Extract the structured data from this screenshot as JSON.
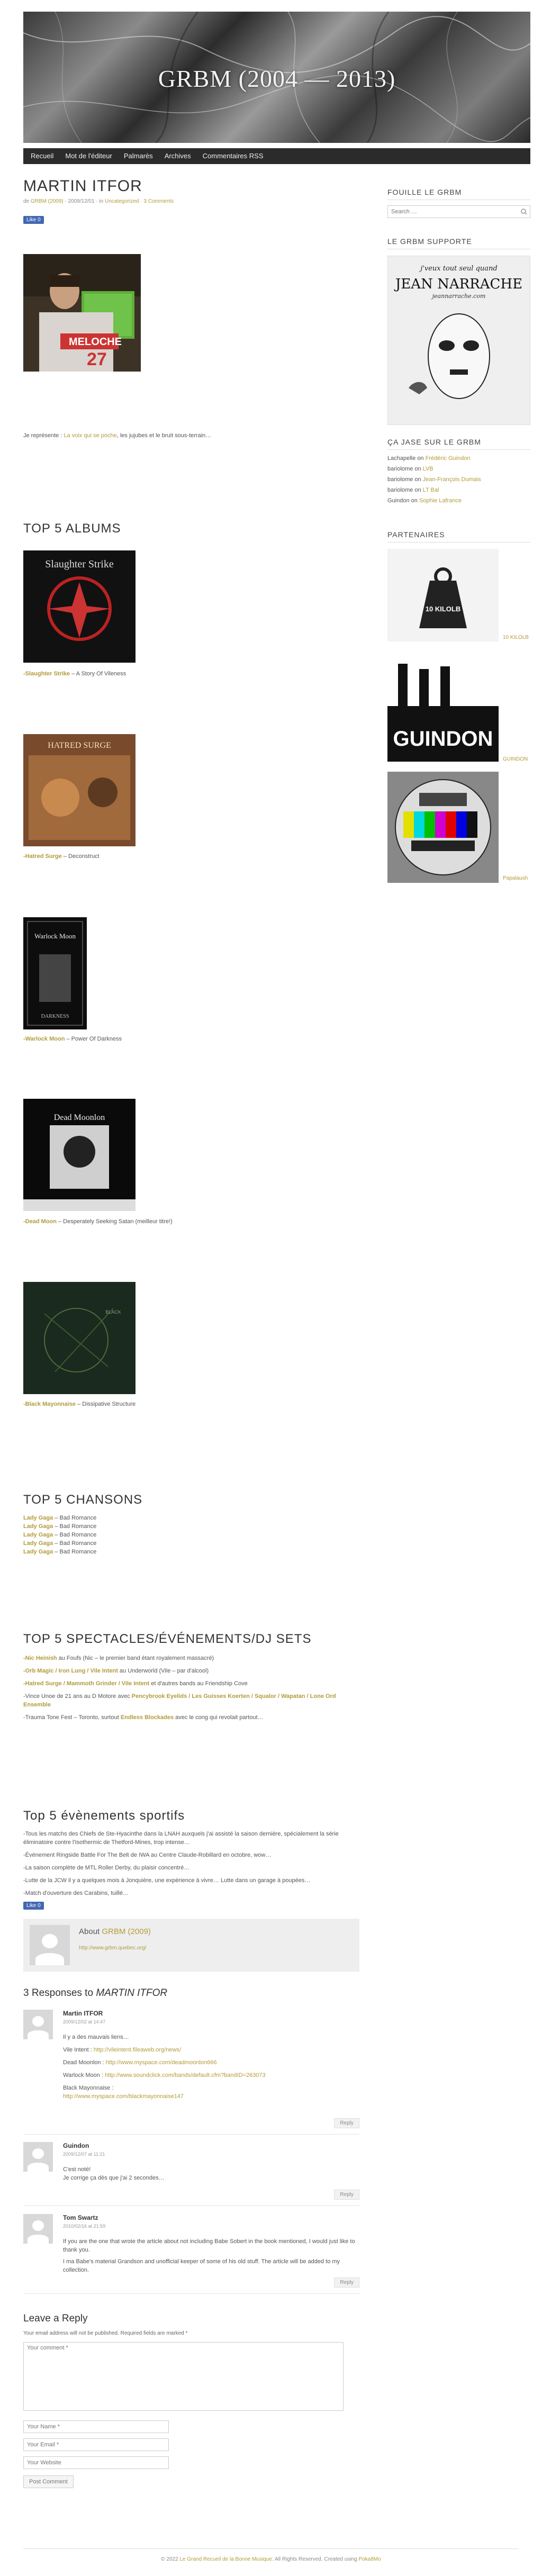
{
  "header": {
    "site_title": "GRBM (2004 — 2013)",
    "nav": [
      "Recueil",
      "Mot de l'éditeur",
      "Palmarès",
      "Archives",
      "Commentaires RSS"
    ]
  },
  "post": {
    "title": "MARTIN ITFOR",
    "meta_by": "de",
    "meta_author": "GRBM (2009)",
    "meta_in": "· 2009/12/01 · in",
    "meta_category": "Uncategorized",
    "meta_comments": "3 Comments",
    "like_label": "Like 0",
    "intro_pre": "Je représente :",
    "intro_link": "La voix qui se poche",
    "intro_post": ", les jujubes et le bruit sous-terrain…"
  },
  "albums": {
    "heading": "TOP 5 ALBUMS",
    "items": [
      {
        "artist": "-Slaughter Strike",
        "title": " – A Story Of Vileness"
      },
      {
        "artist": "-Hatred Surge",
        "title": " – Deconstruct"
      },
      {
        "artist": "-Warlock Moon",
        "title": " – Power Of Darkness"
      },
      {
        "artist": "-Dead Moon",
        "title": " – Desperately Seeking Satan (meilleur titre!)"
      },
      {
        "artist": "-Black Mayonnaise",
        "title": " – Dissipative Structure"
      }
    ]
  },
  "songs": {
    "heading": "TOP 5 CHANSONS",
    "items": [
      {
        "artist": "Lady Gaga",
        "title": " – Bad Romance"
      },
      {
        "artist": "Lady Gaga",
        "title": " – Bad Romance"
      },
      {
        "artist": "Lady Gaga",
        "title": " – Bad Romance"
      },
      {
        "artist": "Lady Gaga",
        "title": " – Bad Romance"
      },
      {
        "artist": "Lady Gaga",
        "title": " – Bad Romance"
      }
    ]
  },
  "shows": {
    "heading": "TOP 5 SPECTACLES/ÉVÉNEMENTS/DJ SETS",
    "items": [
      {
        "a": "-Nic Heinish",
        "b": " au Foufs (Nic – le premier band étant royalement massacré)"
      },
      {
        "a": "-Orb Magic / Iron Lung / Vile Intent",
        "b": " au Underworld (Vile – par d'alcool)"
      },
      {
        "a": "-Hatred Surge / Mammoth Grinder / Vile Intent",
        "b": " et d'autres bands au Friendship Cove"
      },
      {
        "a": "",
        "b": "-Vince Unoe de 21 ans au D Motore avec",
        "c": "Pencybrook Eyelids / Les Guisses Koerten / Squalor / Wapatan / Lone Ord Ensemble"
      },
      {
        "a": "",
        "b": "-Trauma Tone Fest – Toronto, surtout",
        "c": "Endless Blockades",
        "d": " avec le cong qui revolait partout…"
      }
    ]
  },
  "sports": {
    "heading": "Top 5 évènements sportifs",
    "lines": [
      "-Tous les matchs des Chiefs de Ste-Hyacinthe dans la LNAH auxquels j'ai assisté la saison dernière, spécialement la série éliminatoire contre l'Isothermic de Thetford-Mines, trop intense…",
      "-Événement Ringside Battle For The Belt de IWA au Centre Claude-Robillard en octobre, wow…",
      "-La saison complète de MTL Roller Derby, du plaisir concentré…",
      "-Lutte de la JCW il y a quelques mois à Jonquière, une expérience à vivre… Lutte dans un garage à poupées…",
      "-Match d'ouverture des Carabins, tuillé…"
    ],
    "like_label": "Like 0"
  },
  "about": {
    "title_pre": "About",
    "title_link": "GRBM (2009)",
    "url": "http://www.grbm.quebec.org/"
  },
  "comments": {
    "heading_pre": "3 Responses to",
    "heading_em": "MARTIN ITFOR",
    "reply_label": "Reply",
    "items": [
      {
        "author": "Martin ITFOR",
        "date": "2009/12/02 at 14:47",
        "lines": [
          {
            "t": "Il y a des mauvais liens…",
            "l": ""
          },
          {
            "t": "Vile Intent : ",
            "l": "http://vileintent.fileaweb.org/news/"
          },
          {
            "t": "Dead Moonlon : ",
            "l": "http://www.myspace.com/deadmoonlon666"
          },
          {
            "t": "Warlock Moon : ",
            "l": "http://www.soundclick.com/bands/default.cfm?bandID=263073"
          },
          {
            "t": "Black Mayonnaise :",
            "l": ""
          },
          {
            "t": "",
            "l": "http://www.myspace.com/blackmayonnaise147"
          }
        ]
      },
      {
        "author": "Guindon",
        "date": "2009/12/07 at 11:21",
        "lines": [
          {
            "t": "C'est noté!",
            "l": ""
          },
          {
            "t": "Je corrige ça dès que j'ai 2 secondes…",
            "l": ""
          }
        ]
      },
      {
        "author": "Tom Swartz",
        "date": "2010/02/16 at 21:59",
        "lines": [
          {
            "t": "If you are the one that wrote the article about not including Babe Sobert in the book mentioned, I would just like to thank you.",
            "l": ""
          },
          {
            "t": "I ma Babe's material Grandson and unofficial keeper of some of his old stuff. The article will be added to my collection.",
            "l": ""
          }
        ]
      }
    ]
  },
  "reply_form": {
    "heading": "Leave a Reply",
    "note": "Your email address will not be published. Required fields are marked *",
    "comment_ph": "Your comment *",
    "name_ph": "Your Name *",
    "email_ph": "Your Email *",
    "website_ph": "Your Website",
    "submit": "Post Comment"
  },
  "sidebar": {
    "search_heading": "FOUILLE LE GRBM",
    "search_ph": "Search …",
    "support_heading": "LE GRBM SUPPORTE",
    "poster_top": "j'veux tout seul quand",
    "poster_name": "JEAN NARRACHE",
    "poster_site": "jeannarrache.com",
    "recent_heading": "ÇA JASE SUR LE GRBM",
    "recent": [
      {
        "who": "Lachapelle on ",
        "what": "Frédéric Guindon"
      },
      {
        "who": "bariolome on ",
        "what": "LVB"
      },
      {
        "who": "bariolome on ",
        "what": "Jean-François Dumais"
      },
      {
        "who": "bariolome on ",
        "what": "LT Bal"
      },
      {
        "who": "Guindon on ",
        "what": "Sophie Lafrance"
      }
    ],
    "partners_heading": "PARTENAIRES",
    "partners": [
      {
        "label": "10 KILOLB",
        "logo_text": "10 KILOLB"
      },
      {
        "label": "GUINDON",
        "logo_text": "GUINDON"
      },
      {
        "label": "Papalaush",
        "logo_text": ""
      }
    ]
  },
  "footer": {
    "pre": "© 2022",
    "link": "Le Grand Recueil de la Bonne Musique",
    "post": ". All Rights Reserved. Created using",
    "theme": "Poka8Mo"
  }
}
